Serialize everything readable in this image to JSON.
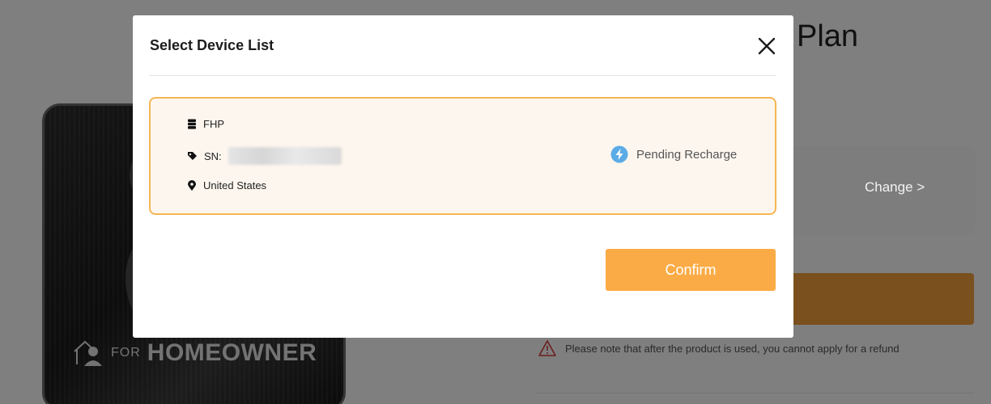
{
  "background": {
    "title": "Plan",
    "card": {
      "for_label": "FOR",
      "audience_label": "HOMEOWNER"
    },
    "change_link": "Change >",
    "refund_notice": "Please note that after the product is used, you cannot apply for a refund"
  },
  "modal": {
    "title": "Select Device List",
    "close_icon": "close-icon",
    "device": {
      "model": "FHP",
      "sn_label": "SN:",
      "location": "United States",
      "status": "Pending Recharge"
    },
    "confirm_label": "Confirm"
  },
  "colors": {
    "accent": "#fbab45",
    "device_border": "#f6b653",
    "device_bg": "#fdf6ee",
    "status_icon": "#5aabe6"
  }
}
